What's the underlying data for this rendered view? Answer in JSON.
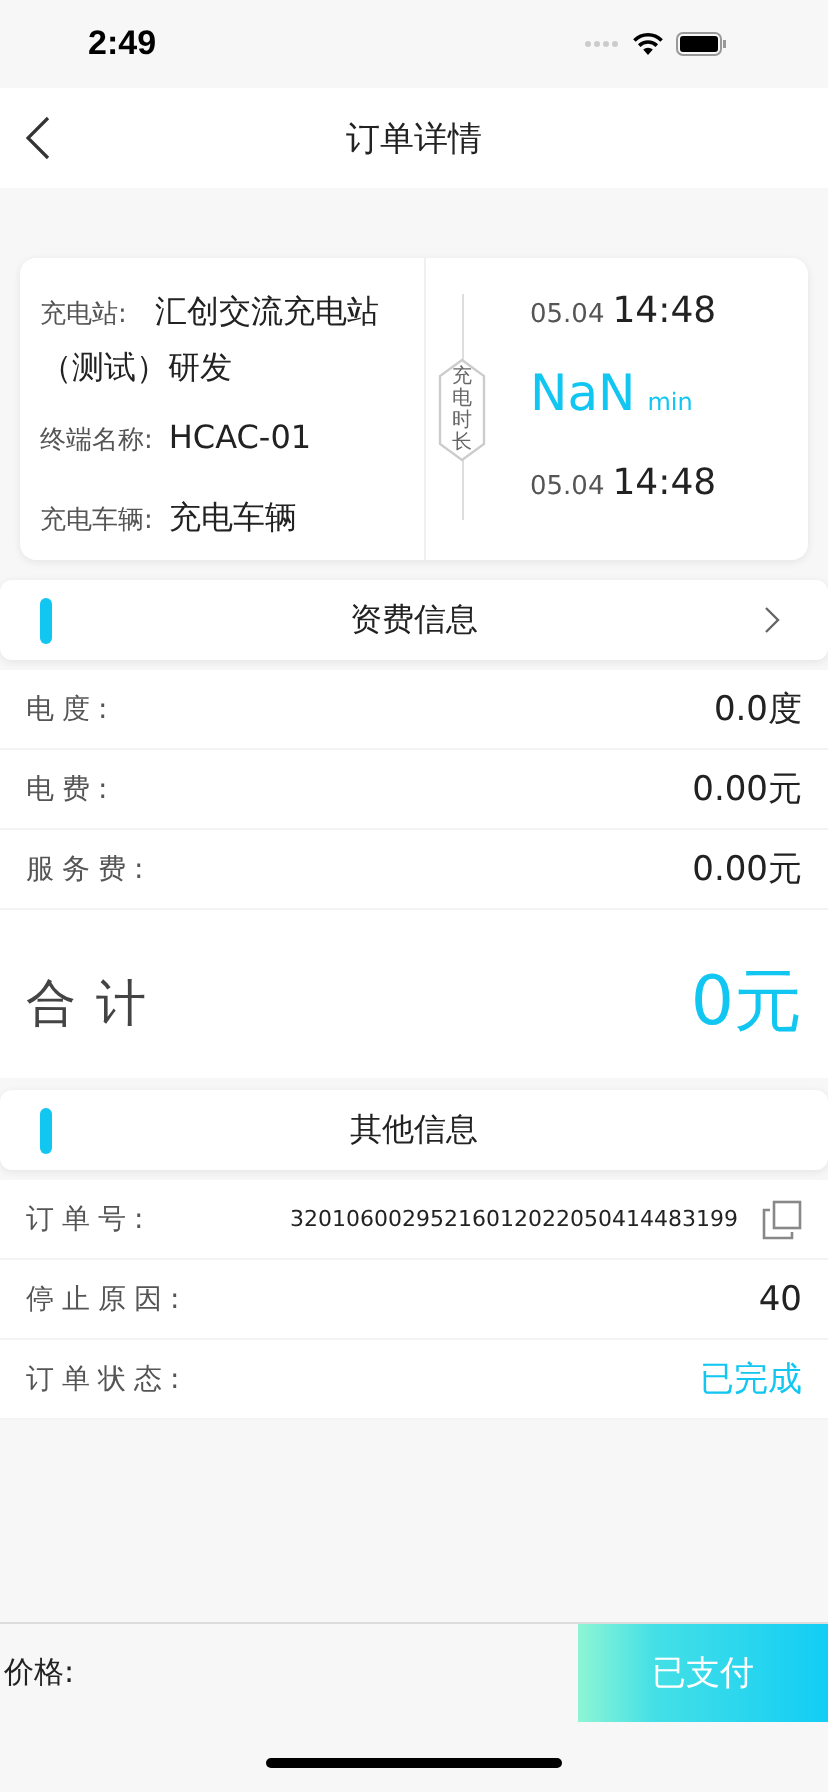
{
  "status_bar": {
    "time": "2:49"
  },
  "nav": {
    "title": "订单详情"
  },
  "charge_card": {
    "station_label": "充电站:",
    "station": "汇创交流充电站（测试）研发",
    "terminal_label": "终端名称:",
    "terminal": "HCAC-01",
    "vehicle_label": "充电车辆:",
    "vehicle": "充电车辆",
    "duration_label": "充电时长",
    "start_date": "05.04",
    "start_time": "14:48",
    "duration": "NaN",
    "duration_unit": "min",
    "end_date": "05.04",
    "end_time": "14:48"
  },
  "fee_section": {
    "title": "资费信息",
    "rows": [
      {
        "label": "电度:",
        "value": "0.0度"
      },
      {
        "label": "电费:",
        "value": "0.00元"
      },
      {
        "label": "服务费:",
        "value": "0.00元"
      }
    ],
    "total_label": "合计",
    "total": "0元"
  },
  "other_section": {
    "title": "其他信息",
    "rows": [
      {
        "label": "订单号:",
        "value": "32010600295216012022050414483199",
        "kind": "copy"
      },
      {
        "label": "停止原因:",
        "value": "40",
        "kind": "plain"
      },
      {
        "label": "订单状态:",
        "value": "已完成",
        "kind": "status"
      }
    ]
  },
  "footer": {
    "price_label": "价格:",
    "pay_button": "已支付"
  }
}
